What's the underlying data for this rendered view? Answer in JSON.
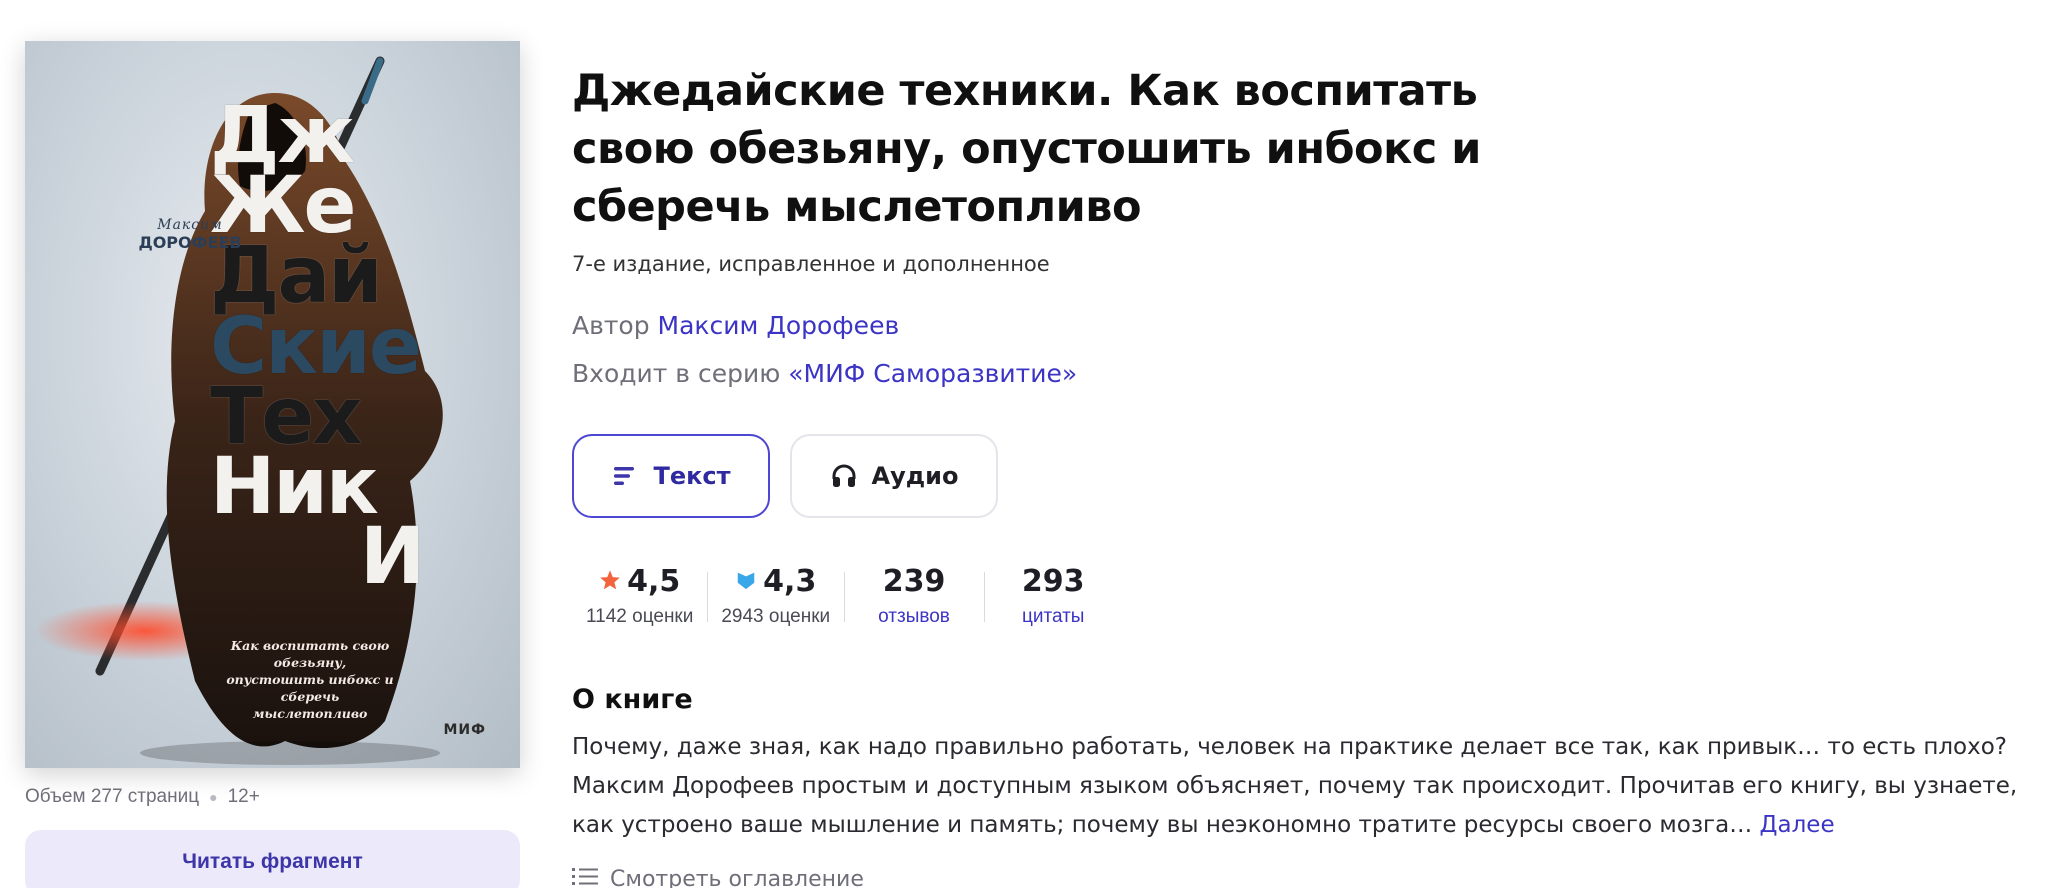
{
  "book": {
    "title": "Джедайские техники. Как воспитать свою обезьяну, опустошить инбокс и сберечь мыслетопливо",
    "edition": "7-е издание, исправленное и дополненное",
    "author_prefix": "Автор",
    "author_name": "Максим Дорофеев",
    "series_prefix": "Входит в серию",
    "series_name": "«МИФ Саморазвитие»"
  },
  "cover": {
    "author_first": "Максим",
    "author_last": "ДОРОФЕЕВ",
    "title_lines": [
      "Дж",
      "Же",
      "Дай",
      "Ские",
      "Тех",
      "Ник",
      "И"
    ],
    "subtitle": "Как воспитать свою обезьяну, опустошить инбокс и сберечь мыслетопливо",
    "publisher": "МИФ"
  },
  "meta": {
    "volume": "Объем 277 страниц",
    "age": "12+"
  },
  "actions": {
    "read_fragment": "Читать фрагмент",
    "format_text": "Текст",
    "format_audio": "Аудио"
  },
  "stats": [
    {
      "icon": "star-icon",
      "value": "4,5",
      "label": "1142 оценки"
    },
    {
      "icon": "bookmate-icon",
      "value": "4,3",
      "label": "2943 оценки"
    },
    {
      "icon": "",
      "value": "239",
      "label": "отзывов"
    },
    {
      "icon": "",
      "value": "293",
      "label": "цитаты"
    }
  ],
  "about": {
    "heading": "О книге",
    "text": "Почему, даже зная, как надо правильно работать, человек на практике делает все так, как привык… то есть плохо? Максим Дорофеев простым и доступным языком объясняет, почему так происходит. Прочитав его книгу, вы узнаете, как устроено ваше мышление и память; почему вы неэкономно тратите ресурсы своего мозга…",
    "more": "Далее",
    "toc": "Смотреть оглавление"
  },
  "colors": {
    "accent": "#3b34c4",
    "star": "#f2643d",
    "bookmate": "#3aa7e8"
  }
}
